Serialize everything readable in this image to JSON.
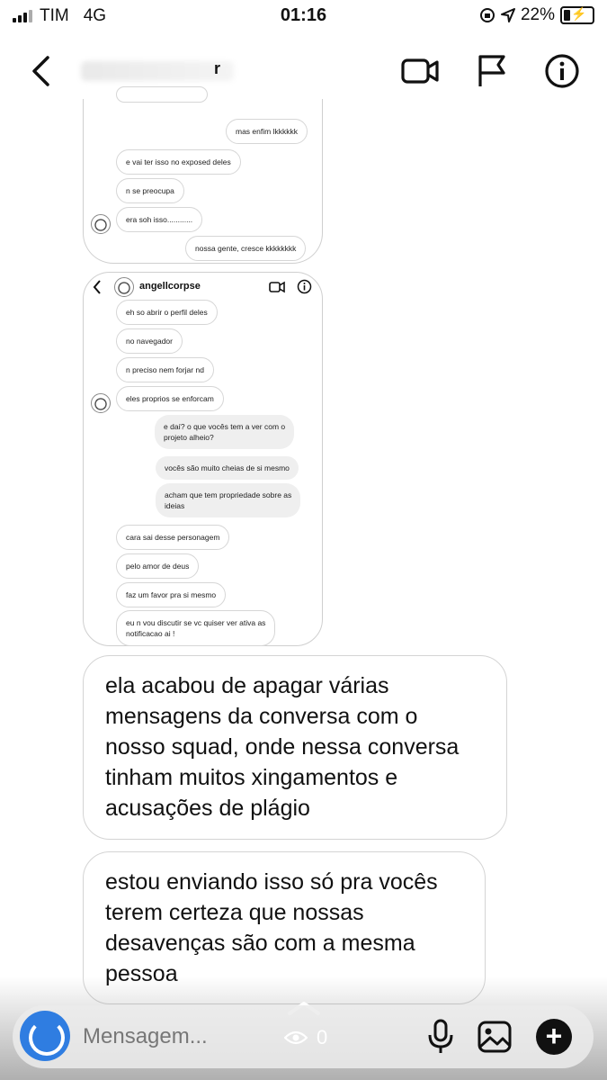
{
  "status_bar": {
    "carrier": "TIM",
    "network": "4G",
    "time": "01:16",
    "battery": "22%"
  },
  "header": {
    "initial": "r",
    "icons": [
      "back-icon",
      "video-icon",
      "flag-icon",
      "info-icon"
    ]
  },
  "screenshot1": {
    "messages": [
      {
        "text": "mas enfim lkkkkkk",
        "side": "out"
      },
      {
        "text": "e vai ter isso no exposed deles",
        "side": "in"
      },
      {
        "text": "n se preocupa",
        "side": "in"
      },
      {
        "text": "era soh isso............",
        "side": "in"
      },
      {
        "text": "nossa gente, cresce kkkkkkkk",
        "side": "out"
      }
    ]
  },
  "screenshot2": {
    "username": "angellcorpse",
    "messages": [
      {
        "text": "eh so abrir o perfil deles",
        "side": "in"
      },
      {
        "text": "no navegador",
        "side": "in"
      },
      {
        "text": "n preciso nem forjar nd",
        "side": "in"
      },
      {
        "text": "eles proprios se enforcam",
        "side": "in"
      },
      {
        "text": "e daí? o que vocês tem a ver com o\nprojeto alheio?",
        "side": "out"
      },
      {
        "text": "vocês são muito cheias de si mesmo",
        "side": "out"
      },
      {
        "text": "acham que tem propriedade sobre as\nideias",
        "side": "out"
      },
      {
        "text": "cara sai desse personagem",
        "side": "in"
      },
      {
        "text": "pelo amor de deus",
        "side": "in"
      },
      {
        "text": "faz um favor pra si mesmo",
        "side": "in"
      },
      {
        "text": "eu n vou discutir se vc quiser ver ativa as\nnotificacao ai !",
        "side": "in"
      }
    ]
  },
  "messages": [
    {
      "text": "ela acabou de apagar várias\nmensagens da conversa com o\nnosso squad, onde nessa conversa\ntinham muitos xingamentos e\nacusações de plágio"
    },
    {
      "text": "estou enviando isso só pra vocês\nterem certeza que nossas\ndesavenças são com a mesma\npessoa"
    }
  ],
  "composer": {
    "placeholder": "Mensagem...",
    "view_count": "0"
  },
  "colors": {
    "camera_button": "#2f7de1",
    "background": "#ffffff"
  }
}
